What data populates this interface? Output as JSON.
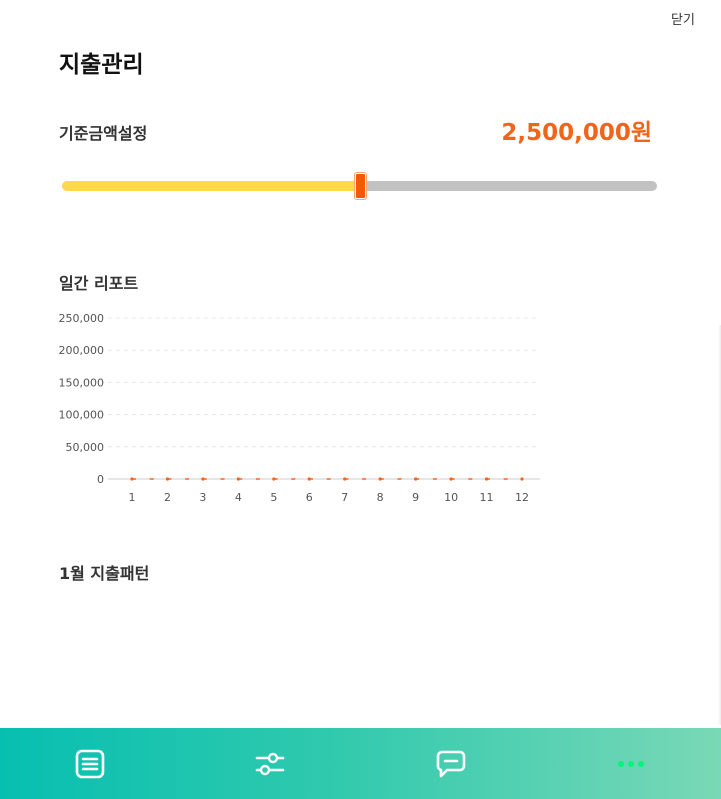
{
  "header": {
    "close_label": "닫기",
    "title": "지출관리"
  },
  "budget": {
    "label": "기준금액설정",
    "amount_text": "2,500,000원",
    "slider_fraction": 0.5
  },
  "daily_report": {
    "label": "일간 리포트"
  },
  "pattern": {
    "label": "1월 지출패턴"
  },
  "colors": {
    "accent_orange": "#f26419",
    "slider_fill": "#ffd84d",
    "slider_track": "#c2c2c2",
    "tabbar_gradient_start": "#07bfb0",
    "tabbar_gradient_end": "#79d8b6",
    "active_tab": "#00f57a"
  },
  "tabbar": {
    "tabs": [
      {
        "icon": "list-icon"
      },
      {
        "icon": "sliders-icon"
      },
      {
        "icon": "chat-icon"
      },
      {
        "icon": "more-icon",
        "active": true
      }
    ]
  },
  "chart_data": {
    "type": "line",
    "x": [
      1,
      2,
      3,
      4,
      5,
      6,
      7,
      8,
      9,
      10,
      11,
      12
    ],
    "x_ticks": [
      "1",
      "2",
      "3",
      "4",
      "5",
      "6",
      "7",
      "8",
      "9",
      "10",
      "11",
      "12"
    ],
    "y_ticks": [
      "0",
      "50,000",
      "100,000",
      "150,000",
      "200,000",
      "250,000"
    ],
    "ylim": [
      0,
      250000
    ],
    "grid": true,
    "series": [
      {
        "values": [
          0,
          0,
          0,
          0,
          0,
          0,
          0,
          0,
          0,
          0,
          0,
          0
        ],
        "color": "#f26419"
      }
    ]
  }
}
